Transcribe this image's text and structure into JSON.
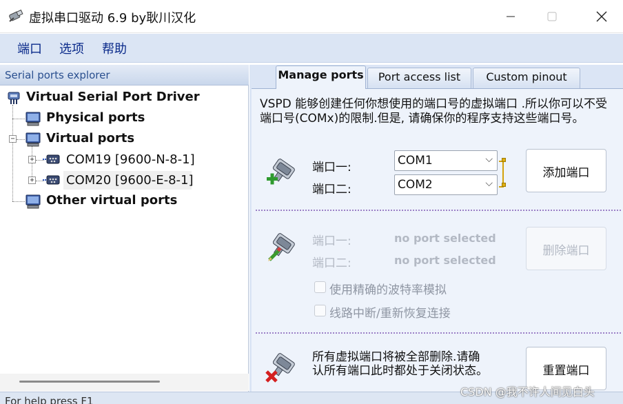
{
  "window": {
    "title": "虚拟串口驱动 6.9 by耿川汉化",
    "icon": "serial-plug-icon",
    "controls": [
      "minimize-icon",
      "maximize-icon",
      "close-icon"
    ]
  },
  "menu": {
    "items": [
      "端口",
      "选项",
      "帮助"
    ]
  },
  "explorer": {
    "header": "Serial ports explorer",
    "root": "Virtual Serial Port Driver",
    "physical": "Physical ports",
    "virtual": "Virtual ports",
    "ports": [
      "COM19 [9600-N-8-1]",
      "COM20 [9600-E-8-1]"
    ],
    "other": "Other virtual ports",
    "selected_port": "COM20 [9600-E-8-1]"
  },
  "status": {
    "text": "For help press F1"
  },
  "tabs": [
    "Manage ports",
    "Port access list",
    "Custom pinout"
  ],
  "active_tab": "Manage ports",
  "manage": {
    "description": "VSPD 能够创建任何你想使用的端口号的虚拟端口 .所以你可以不受端口号(COMx)的限制.但是, 请确保你的程序支持这些端口号。",
    "add": {
      "port1_label": "端口一:",
      "port2_label": "端口二:",
      "port1_value": "COM1",
      "port2_value": "COM2",
      "button": "添加端口"
    },
    "remove": {
      "port1_label": "端口一:",
      "port2_label": "端口二:",
      "port1_value": "no port selected",
      "port2_value": "no port selected",
      "button": "删除端口",
      "option_baud": "使用精确的波特率模拟",
      "option_reconnect": "线路中断/重新恢复连接"
    },
    "reset": {
      "text": "所有虚拟端口将被全部删除.请确认所有端口此时都处于关闭状态。",
      "button": "重置端口"
    }
  },
  "watermark": "CSDN @我不许人间见白头",
  "colors": {
    "menu_bg": "#dbe5f4",
    "pane_bg": "#eef3fb",
    "menu_text": "#0a2a8a",
    "separator": "#9b7fc6",
    "bracket": "#d4a20a"
  }
}
